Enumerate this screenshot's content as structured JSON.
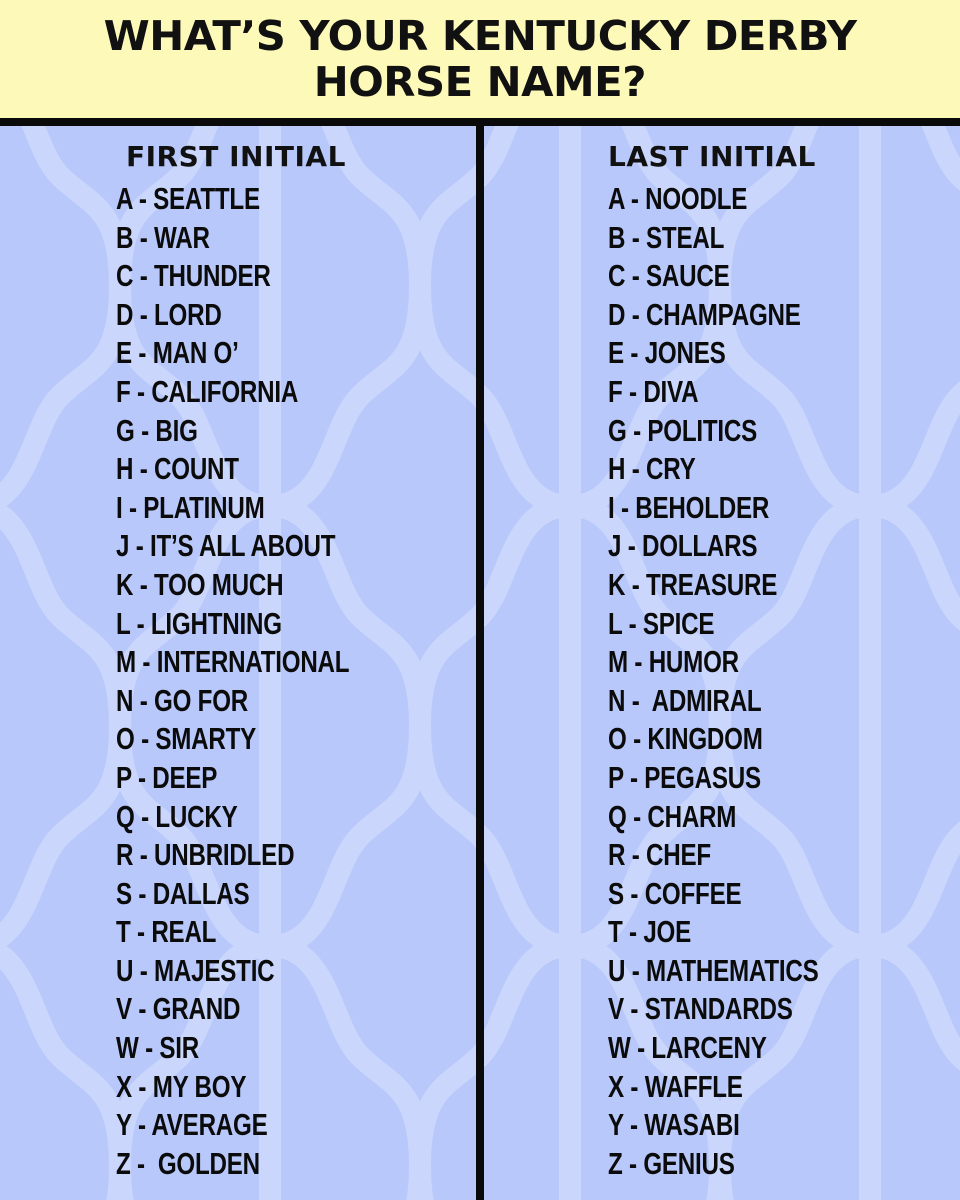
{
  "header": {
    "title_lines": [
      "WHAT’S YOUR KENTUCKY DERBY",
      "HORSE NAME?"
    ]
  },
  "colors": {
    "header_bg": "#fdf9b8",
    "body_bg": "#b8c8fa",
    "pattern_line": "#cad6fc",
    "text": "#0b0b0b",
    "divider": "#0a0a0a"
  },
  "first_initial": {
    "heading": "FIRST INITIAL",
    "entries": [
      {
        "letter": "A",
        "word": "SEATTLE"
      },
      {
        "letter": "B",
        "word": "WAR"
      },
      {
        "letter": "C",
        "word": "THUNDER"
      },
      {
        "letter": "D",
        "word": "LORD"
      },
      {
        "letter": "E",
        "word": "MAN O’"
      },
      {
        "letter": "F",
        "word": "CALIFORNIA"
      },
      {
        "letter": "G",
        "word": "BIG"
      },
      {
        "letter": "H",
        "word": "COUNT"
      },
      {
        "letter": "I",
        "word": "PLATINUM"
      },
      {
        "letter": "J",
        "word": "IT’S ALL ABOUT"
      },
      {
        "letter": "K",
        "word": "TOO MUCH"
      },
      {
        "letter": "L",
        "word": "LIGHTNING"
      },
      {
        "letter": "M",
        "word": "INTERNATIONAL"
      },
      {
        "letter": "N",
        "word": "GO FOR"
      },
      {
        "letter": "O",
        "word": "SMARTY"
      },
      {
        "letter": "P",
        "word": "DEEP"
      },
      {
        "letter": "Q",
        "word": "LUCKY"
      },
      {
        "letter": "R",
        "word": "UNBRIDLED"
      },
      {
        "letter": "S",
        "word": "DALLAS"
      },
      {
        "letter": "T",
        "word": "REAL"
      },
      {
        "letter": "U",
        "word": "MAJESTIC"
      },
      {
        "letter": "V",
        "word": "GRAND"
      },
      {
        "letter": "W",
        "word": "SIR"
      },
      {
        "letter": "X",
        "word": "MY BOY"
      },
      {
        "letter": "Y",
        "word": "AVERAGE"
      },
      {
        "letter": "Z",
        "word": " GOLDEN"
      }
    ]
  },
  "last_initial": {
    "heading": "LAST INITIAL",
    "entries": [
      {
        "letter": "A",
        "word": "NOODLE"
      },
      {
        "letter": "B",
        "word": "STEAL"
      },
      {
        "letter": "C",
        "word": "SAUCE"
      },
      {
        "letter": "D",
        "word": "CHAMPAGNE"
      },
      {
        "letter": "E",
        "word": "JONES"
      },
      {
        "letter": "F",
        "word": "DIVA"
      },
      {
        "letter": "G",
        "word": "POLITICS"
      },
      {
        "letter": "H",
        "word": "CRY"
      },
      {
        "letter": "I",
        "word": "BEHOLDER"
      },
      {
        "letter": "J",
        "word": "DOLLARS"
      },
      {
        "letter": "K",
        "word": "TREASURE"
      },
      {
        "letter": "L",
        "word": "SPICE"
      },
      {
        "letter": "M",
        "word": "HUMOR"
      },
      {
        "letter": "N",
        "word": " ADMIRAL"
      },
      {
        "letter": "O",
        "word": "KINGDOM"
      },
      {
        "letter": "P",
        "word": "PEGASUS"
      },
      {
        "letter": "Q",
        "word": "CHARM"
      },
      {
        "letter": "R",
        "word": "CHEF"
      },
      {
        "letter": "S",
        "word": "COFFEE"
      },
      {
        "letter": "T",
        "word": "JOE"
      },
      {
        "letter": "U",
        "word": "MATHEMATICS"
      },
      {
        "letter": "V",
        "word": "STANDARDS"
      },
      {
        "letter": "W",
        "word": "LARCENY"
      },
      {
        "letter": "X",
        "word": "WAFFLE"
      },
      {
        "letter": "Y",
        "word": "WASABI"
      },
      {
        "letter": "Z",
        "word": "GENIUS"
      }
    ]
  },
  "separator": " - "
}
